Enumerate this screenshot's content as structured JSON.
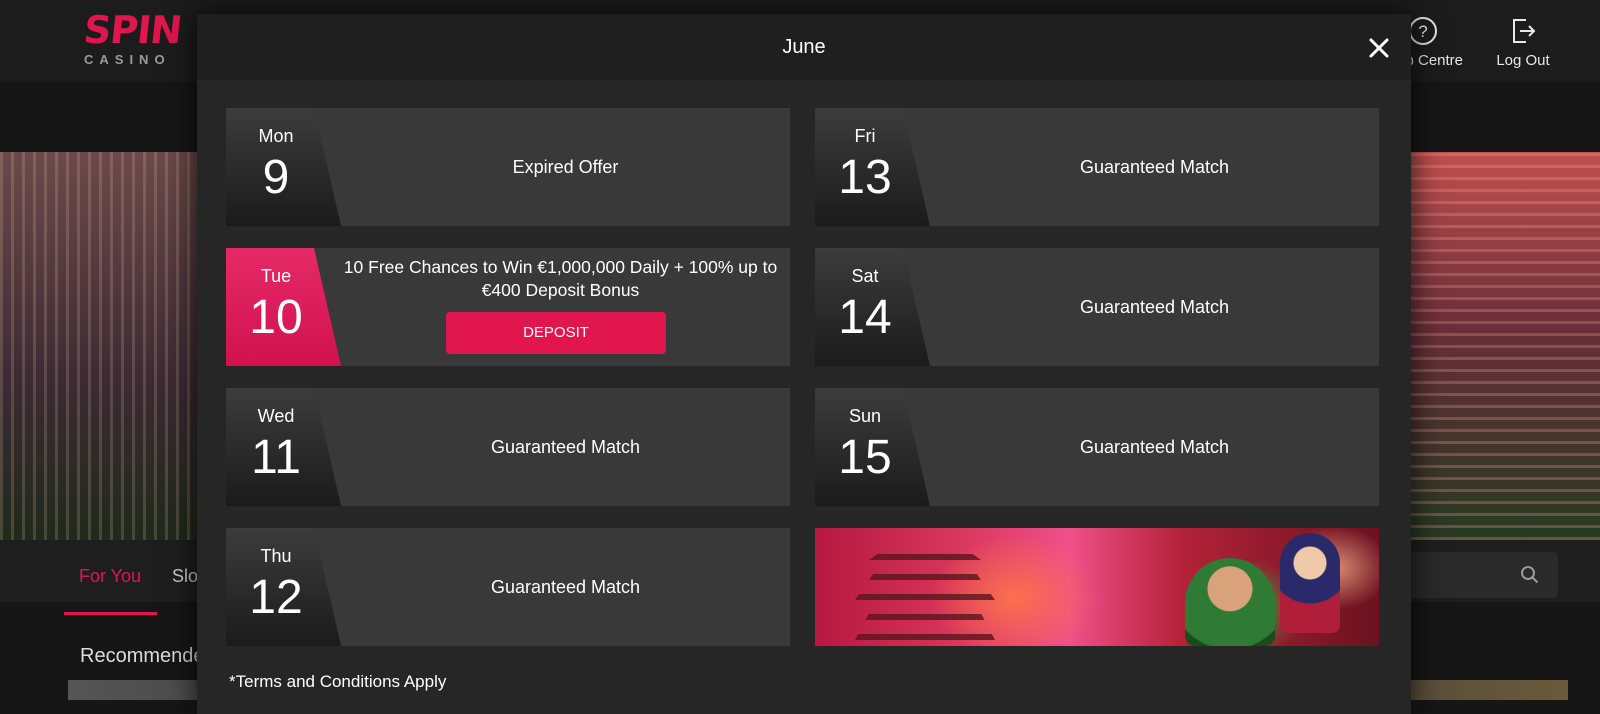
{
  "header": {
    "logo_main": "SPIN",
    "logo_sub": "CASINO",
    "help_label": "Help Centre",
    "logout_label": "Log Out"
  },
  "page": {
    "tabs": [
      {
        "label": "For You"
      },
      {
        "label": "Slots"
      }
    ],
    "section_title": "Recommended"
  },
  "modal": {
    "title": "June",
    "terms": "*Terms and Conditions Apply",
    "days": [
      {
        "weekday": "Mon",
        "day": "9",
        "text": "Expired Offer"
      },
      {
        "weekday": "Tue",
        "day": "10",
        "text": "10 Free Chances to Win €1,000,000 Daily + 100% up to €400 Deposit Bonus",
        "button": "DEPOSIT"
      },
      {
        "weekday": "Wed",
        "day": "11",
        "text": "Guaranteed Match"
      },
      {
        "weekday": "Thu",
        "day": "12",
        "text": "Guaranteed Match"
      },
      {
        "weekday": "Fri",
        "day": "13",
        "text": "Guaranteed Match"
      },
      {
        "weekday": "Sat",
        "day": "14",
        "text": "Guaranteed Match"
      },
      {
        "weekday": "Sun",
        "day": "15",
        "text": "Guaranteed Match"
      }
    ]
  },
  "colors": {
    "accent": "#e1164f",
    "card": "#393939",
    "modal": "#262626"
  }
}
